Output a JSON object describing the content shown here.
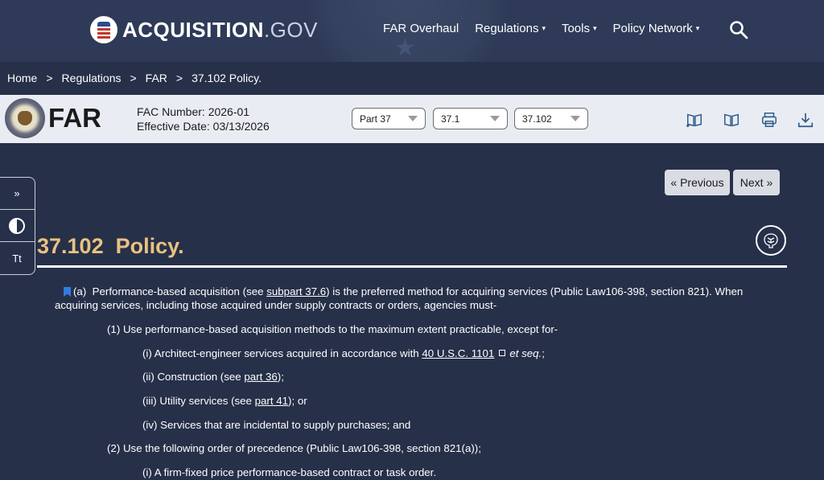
{
  "header": {
    "logo_main": "ACQUISITION",
    "logo_suffix": ".GOV",
    "nav": [
      {
        "label": "FAR Overhaul"
      },
      {
        "label": "Regulations",
        "caret": "▾"
      },
      {
        "label": "Tools",
        "caret": "▾"
      },
      {
        "label": "Policy Network",
        "caret": "▾"
      }
    ],
    "search_icon": "search-icon"
  },
  "breadcrumb": {
    "items": [
      "Home",
      "Regulations",
      "FAR",
      "37.102 Policy."
    ],
    "separator": ">"
  },
  "farbar": {
    "title": "FAR",
    "fac_number": "FAC Number: 2026-01",
    "effective_date": "Effective Date: 03/13/2026",
    "selects": {
      "part": "Part 37",
      "subpart": "37.1",
      "section": "37.102"
    },
    "icons": [
      "book-open-add-icon",
      "book-open-icon",
      "printer-icon",
      "download-icon"
    ]
  },
  "side_tools": {
    "expand": "»",
    "contrast_icon": "contrast-icon",
    "text_size": "Tt"
  },
  "pager": {
    "previous": "« Previous",
    "next": "Next »"
  },
  "section": {
    "number": "37.102",
    "title": "Policy."
  },
  "content": {
    "a_label": "(a)",
    "a_text_1": "Performance-based acquisition (see",
    "a_link": "subpart 37.6",
    "a_text_2": ") is the preferred method for acquiring services (Public Law106-398, section 821). When",
    "a_line2": "acquiring services, including those acquired under supply contracts or orders, agencies must-",
    "p1": "(1) Use performance-based acquisition methods to the maximum extent practicable, except for-",
    "p1i_text": "(i) Architect-engineer services acquired in accordance with",
    "p1i_link": "40 U.S.C. 1101",
    "p1i_em": "et seq.",
    "p1i_end": ";",
    "p1ii_text": "(ii) Construction (see",
    "p1ii_link": "part 36",
    "p1ii_end": ");",
    "p1iii_text": "(iii) Utility services (see",
    "p1iii_link": "part 41",
    "p1iii_end": "); or",
    "p1iv": "(iv) Services that are incidental to supply purchases; and",
    "p2": "(2) Use the following order of precedence (Public Law106-398, section 821(a));",
    "p2i": "(i) A firm-fixed price performance-based contract or task order."
  },
  "colors": {
    "background": "#273049",
    "header": "#2e3a57",
    "title": "#e8c281",
    "farbar": "#e9edf3",
    "bookmark": "#2f7de1"
  }
}
